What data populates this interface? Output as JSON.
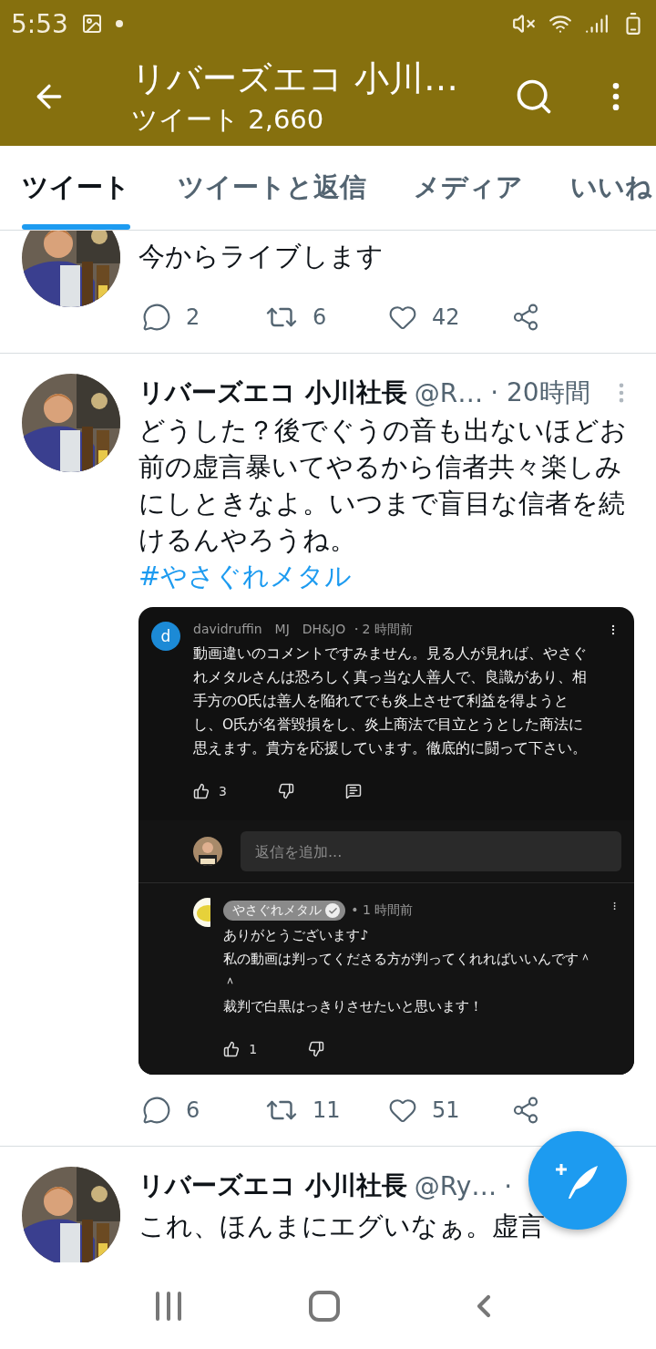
{
  "status_bar": {
    "time": "5:53"
  },
  "header": {
    "title": "リバーズエコ 小川…",
    "subtitle": "ツイート 2,660"
  },
  "tabs": [
    {
      "label": "ツイート",
      "selected": true
    },
    {
      "label": "ツイートと返信",
      "selected": false
    },
    {
      "label": "メディア",
      "selected": false
    },
    {
      "label": "いいね",
      "selected": false
    }
  ],
  "tweets": [
    {
      "kind": "partial",
      "text": "今からライブします",
      "actions": {
        "replies": "2",
        "retweets": "6",
        "likes": "42"
      }
    },
    {
      "kind": "full",
      "name": "リバーズエコ 小川社長",
      "handle": "@R…",
      "time": "· 20時間",
      "text": "どうした？後でぐうの音も出ないほどお前の虚言暴いてやるから信者共々楽しみにしときなよ。いつまで盲目な信者を続けるんやろうね。",
      "hashtag": "#やさぐれメタル",
      "embed": {
        "comment": {
          "avatar_letter": "d",
          "author": "davidruffin　MJ　DH&JO",
          "time": "・2 時間前",
          "text": "動画違いのコメントですみません。見る人が見れば、やさぐれメタルさんは恐ろしく真っ当な人善人で、良識があり、相手方のO氏は善人を陥れてでも炎上させて利益を得ようとし、O氏が名誉毀損をし、炎上商法で目立とうとした商法に思えます。貴方を応援しています。徹底的に闘って下さい。",
          "likes": "3"
        },
        "reply_placeholder": "返信を追加...",
        "reply": {
          "author": "やさぐれメタル",
          "verified": true,
          "time": "• 1 時間前",
          "lines": [
            "ありがとうございます♪",
            "私の動画は判ってくださる方が判ってくれればいいんです＾＾",
            "裁判で白黒はっきりさせたいと思います！"
          ],
          "likes": "1"
        }
      },
      "actions": {
        "replies": "6",
        "retweets": "11",
        "likes": "51"
      }
    },
    {
      "kind": "cut",
      "name": "リバーズエコ 小川社長",
      "handle": "@Ry…",
      "time": "·",
      "text": "これ、ほんまにエグいなぁ。虚言"
    }
  ]
}
